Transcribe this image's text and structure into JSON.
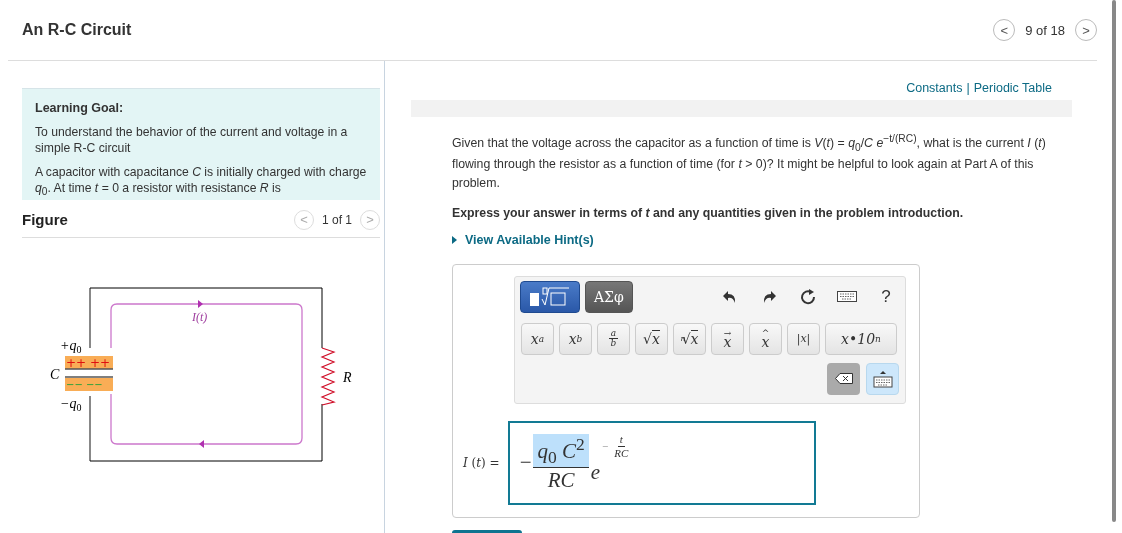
{
  "header": {
    "title": "An R-C Circuit",
    "pager": {
      "prev": "<",
      "text": "9 of 18",
      "next": ">"
    }
  },
  "intro": {
    "heading": "Learning Goal:",
    "paragraphs": [
      "To understand the behavior of the current and voltage in a simple R-C circuit",
      "A capacitor with capacitance *C* is initially charged with charge *q*$_{0}$. At time *t* = 0 a resistor with resistance *R* is"
    ]
  },
  "figure": {
    "heading": "Figure",
    "pager": {
      "prev": "<",
      "text": "1 of 1",
      "next": ">"
    },
    "labels": {
      "plus_charge": "+q",
      "minus_charge": "−q",
      "plus_subscript": "0",
      "minus_subscript": "0",
      "capacitor": "C",
      "current": "I(t)",
      "resistor": "R",
      "plus_signs": "++ ++",
      "minus_signs": "−− −−"
    }
  },
  "links": [
    {
      "label": "Constants"
    },
    {
      "label": "Periodic Table"
    }
  ],
  "link_separator": "|",
  "question": {
    "text": "Given that the voltage across the capacitor as a function of time is *V*(*t*) = *q*$_{0}$/*C* *e*$^{−t/(RC)}$, what is the current *I* (*t*) flowing through the resistor as a function of time (for *t* > 0)? It might be helpful to look again at Part A of this problem.",
    "instruction": "Express your answer in terms of *t* and any quantities given in the problem introduction.",
    "hint_link": "View Available Hint(s)"
  },
  "editor": {
    "tabs": [
      {
        "kind": "templates",
        "selected": true
      },
      {
        "kind": "symbols",
        "label": "ΑΣφ",
        "selected": false
      }
    ],
    "actions": [
      {
        "kind": "undo"
      },
      {
        "kind": "redo"
      },
      {
        "kind": "reset"
      },
      {
        "kind": "keyboard"
      },
      {
        "kind": "help",
        "label": "?"
      }
    ],
    "templates": [
      {
        "kind": "sup",
        "base": "x",
        "mark": "a"
      },
      {
        "kind": "sub",
        "base": "x",
        "mark": "b"
      },
      {
        "kind": "frac",
        "base": "b",
        "mark": "a"
      },
      {
        "kind": "sqrt",
        "base": "x",
        "mark": "√"
      },
      {
        "kind": "nroot",
        "base": "x",
        "mark": "n",
        "radical": "√"
      },
      {
        "kind": "vec",
        "base": "x",
        "mark": "→"
      },
      {
        "kind": "hat",
        "base": "x",
        "mark": "^"
      },
      {
        "kind": "abs",
        "base": "|x|"
      },
      {
        "kind": "sci",
        "base": "x•10",
        "mark": "n"
      }
    ],
    "keyboard_shown": true
  },
  "answer": {
    "label": "*I* (*t*) =",
    "sign": "−",
    "numerator": "*q*$_{0}$ *C*$^{2}$",
    "numerator_selected": true,
    "denominator": "*RC*",
    "base": "*e*",
    "exponent_sign": "−",
    "exponent_numerator": "*t*",
    "exponent_denominator": "*RC*"
  }
}
